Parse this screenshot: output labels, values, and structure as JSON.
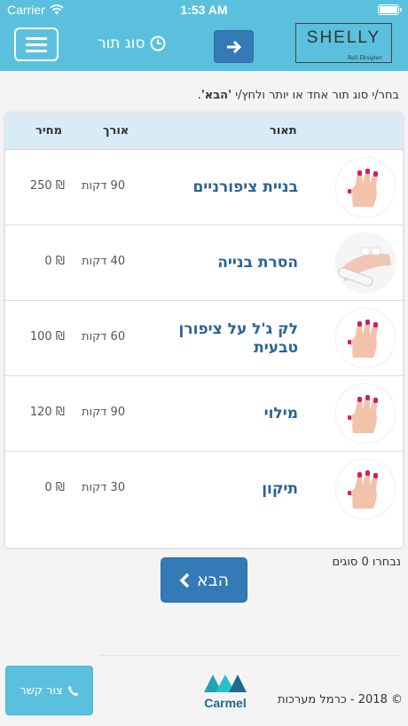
{
  "status_bar": {
    "carrier": "Carrier",
    "time": "1:53 AM"
  },
  "header": {
    "title": "סוג תור",
    "logo_name": "SHELLY",
    "logo_subtitle": "Nail Designer"
  },
  "instructions": {
    "prefix": "בחר/י סוג תור אחד או יותר ולחץ/י ",
    "emphasis": "'הבא'",
    "suffix": "."
  },
  "table": {
    "headers": {
      "description": "תאור",
      "length": "אורך",
      "price": "מחיר"
    },
    "rows": [
      {
        "name": "בניית ציפורניים",
        "length": "90 דקות",
        "price": "₪ 250",
        "image": "pink-nails-icon"
      },
      {
        "name": "הסרת בנייה",
        "length": "40 דקות",
        "price": "₪ 0",
        "image": "nail-file-icon"
      },
      {
        "name": "לק ג'ל על ציפורן טבעית",
        "length": "60 דקות",
        "price": "₪ 100",
        "image": "pink-nails-icon"
      },
      {
        "name": "מילוי",
        "length": "90 דקות",
        "price": "₪ 120",
        "image": "pink-nails-icon"
      },
      {
        "name": "תיקון",
        "length": "30 דקות",
        "price": "₪ 0",
        "image": "pink-nails-icon"
      }
    ]
  },
  "selection": {
    "count_label": "נבחרו 0 סוגים"
  },
  "next_button": {
    "label": "הבא"
  },
  "footer": {
    "contact_label": "צור קשר",
    "carmel_word": "Carmel",
    "copyright": "© 2018 - כרמל מערכות"
  },
  "colors": {
    "header": "#5bc0de",
    "primary": "#337ab7",
    "name_text": "#2a6496",
    "table_head": "#d9ebf5"
  }
}
